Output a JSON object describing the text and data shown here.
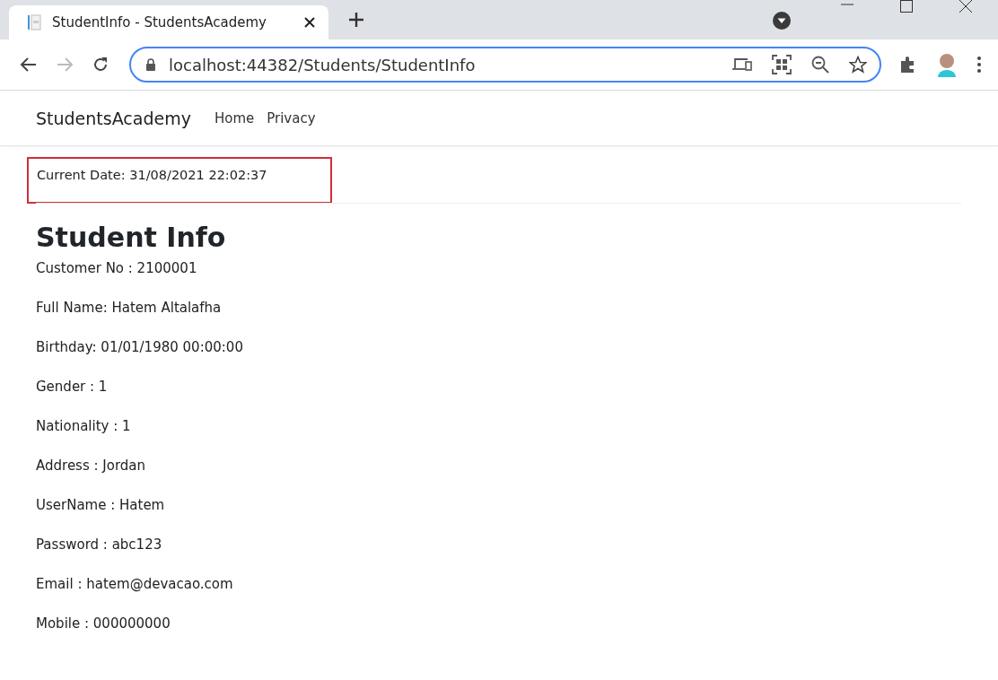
{
  "browser": {
    "tab": {
      "title": "StudentInfo - StudentsAcademy",
      "selected": true
    },
    "address": "localhost:44382/Students/StudentInfo"
  },
  "navbar": {
    "brand": "StudentsAcademy",
    "links": [
      "Home",
      "Privacy"
    ]
  },
  "current_date": "Current Date: 31/08/2021 22:02:37",
  "heading": "Student Info",
  "fields": [
    "Customer No : 2100001",
    "Full Name: Hatem Altalafha",
    "Birthday: 01/01/1980 00:00:00",
    "Gender : 1",
    "Nationality : 1",
    "Address : Jordan",
    "UserName : Hatem",
    "Password : abc123",
    "Email : hatem@devacao.com",
    "Mobile : 000000000"
  ]
}
